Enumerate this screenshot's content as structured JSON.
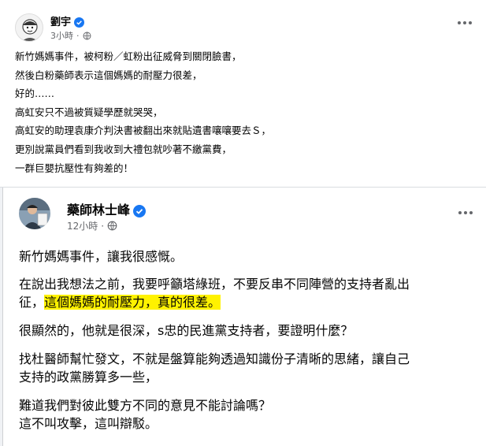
{
  "post1": {
    "author": "劉宇",
    "time": "3小時",
    "dot": "·",
    "lines": [
      "新竹媽媽事件，被柯粉／虹粉出征威脅到關閉臉書，",
      "然後白粉藥師表示這個媽媽的耐壓力很差，",
      "好的……",
      "高虹安只不過被質疑學歷就哭哭，",
      "高虹安的助理袁康介判決書被翻出來就貼遺書嚷嚷要去Ｓ，",
      "更別說黨員們看到我收到大禮包就吵著不繳黨費，",
      "一群巨嬰抗壓性有夠差的！"
    ]
  },
  "post2": {
    "author": "藥師林士峰",
    "time": "12小時",
    "dot": "·",
    "p1": "新竹媽媽事件，讓我很感慨。",
    "p2_line1": "在說出我想法之前，我要呼籲塔綠班，不要反串不同陣營的支持者亂出",
    "p2_line2_plain": "征，",
    "p2_line2_highlight": "這個媽媽的耐壓力，真的很差。",
    "p3": "很顯然的，他就是很深，s忠的民進黨支持者，要證明什麼？",
    "p4_line1": "找杜醫師幫忙發文，不就是盤算能夠透過知識份子清晰的思緒，讓自己",
    "p4_line2": "支持的政黨勝算多一些，",
    "p5_line1": "難道我們對彼此雙方不同的意見不能討論嗎？",
    "p5_line2": "這不叫攻擊，這叫辯駁。"
  },
  "colors": {
    "verified": "#1877f2",
    "highlight": "#fff200",
    "meta": "#65676b"
  }
}
